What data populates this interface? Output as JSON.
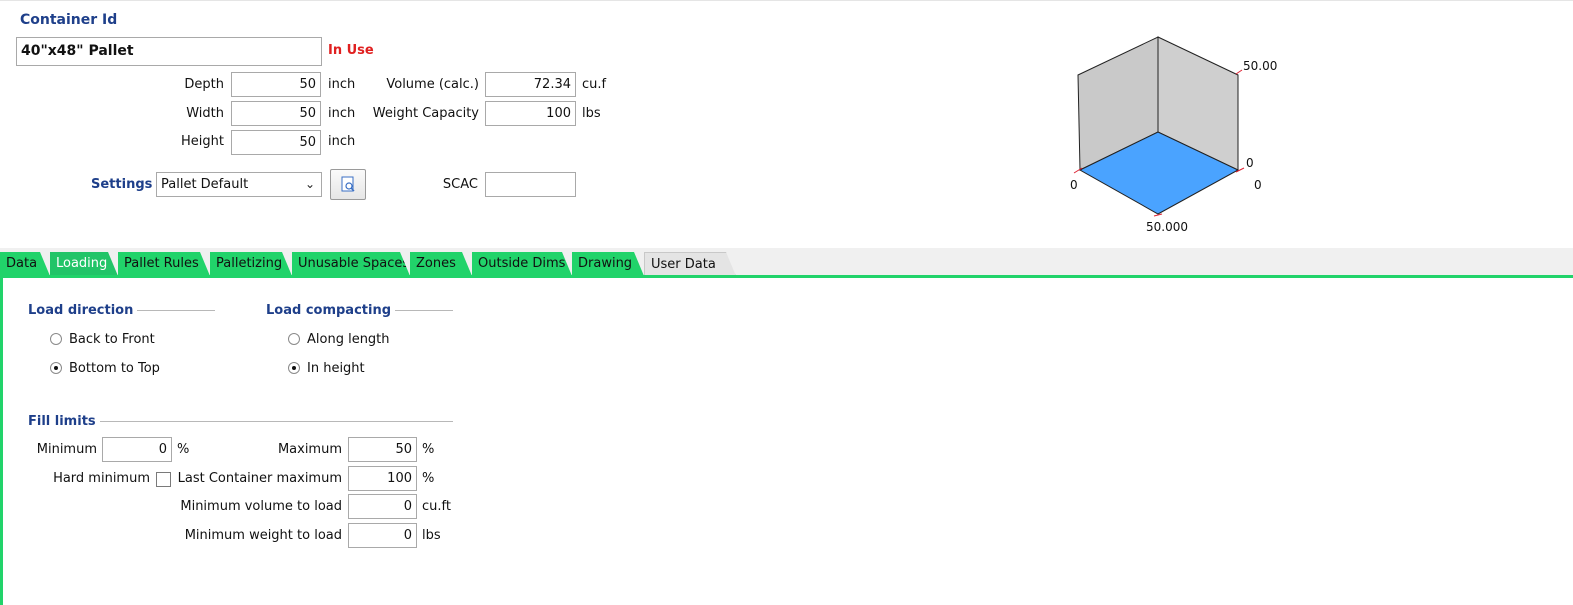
{
  "container": {
    "id_label": "Container Id",
    "id_value": "40\"x48\" Pallet",
    "status": "In Use"
  },
  "dims": {
    "depth_label": "Depth",
    "depth_value": "50",
    "depth_unit": "inch",
    "width_label": "Width",
    "width_value": "50",
    "width_unit": "inch",
    "height_label": "Height",
    "height_value": "50",
    "height_unit": "inch",
    "volume_label": "Volume (calc.)",
    "volume_value": "72.34",
    "volume_unit": "cu.f",
    "weight_label": "Weight Capacity",
    "weight_value": "100",
    "weight_unit": "lbs"
  },
  "settings": {
    "label": "Settings",
    "selected": "Pallet Default",
    "scac_label": "SCAC",
    "scac_value": ""
  },
  "preview": {
    "label_top_right": "50.00",
    "label_right_mid": "0",
    "label_right_low": "0",
    "label_left": "0",
    "label_bottom": "50.000",
    "floor_color": "#4aa3ff"
  },
  "tabs": [
    "Data",
    "Loading",
    "Pallet Rules",
    "Palletizing",
    "Unusable Spaces",
    "Zones",
    "Outside Dims",
    "Drawing",
    "User Data"
  ],
  "active_tab": "Loading",
  "loading": {
    "direction_title": "Load direction",
    "direction_options": [
      "Back to Front",
      "Bottom to Top"
    ],
    "direction_selected": "Bottom to Top",
    "compacting_title": "Load compacting",
    "compacting_options": [
      "Along length",
      "In height"
    ],
    "compacting_selected": "In height",
    "fill_title": "Fill limits",
    "minimum_label": "Minimum",
    "minimum_value": "0",
    "minimum_unit": "%",
    "hard_min_label": "Hard minimum",
    "hard_min_checked": false,
    "maximum_label": "Maximum",
    "maximum_value": "50",
    "maximum_unit": "%",
    "last_max_label": "Last Container maximum",
    "last_max_value": "100",
    "last_max_unit": "%",
    "min_vol_label": "Minimum volume to load",
    "min_vol_value": "0",
    "min_vol_unit": "cu.ft",
    "min_wt_label": "Minimum weight to load",
    "min_wt_value": "0",
    "min_wt_unit": "lbs"
  },
  "colors": {
    "accent_tab": "#21d36a",
    "label_blue": "#1e3f8a",
    "status_red": "#e02020"
  }
}
